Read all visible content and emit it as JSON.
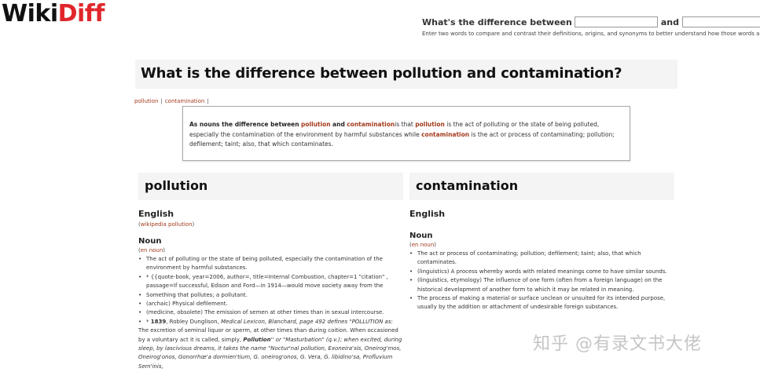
{
  "logo": {
    "wiki": "Wiki",
    "diff": "Diff"
  },
  "compare": {
    "label": "What's the difference between",
    "and_label": "and",
    "input1_value": "",
    "input2_value": "",
    "button_label": "?",
    "help_text": "Enter two words to compare and contrast their definitions, origins, and synonyms to better understand how those words are related."
  },
  "title": "What is the difference between pollution and contamination?",
  "crumbs": {
    "item1": "pollution",
    "sep": "|",
    "item2": "contamination"
  },
  "summary": {
    "lead": "As nouns the difference between",
    "word1": "pollution",
    "and": "and",
    "word2": "contamination",
    "is_that": "is that",
    "word1b": "pollution",
    "def1": "is the act of polluting or the state of being polluted, especially the contamination of the environment by harmful substances while",
    "word2b": "contamination",
    "def2": "is the act or process of contaminating; pollution; defilement; taint; also, that which contaminates."
  },
  "left": {
    "heading": "pollution",
    "language": "English",
    "source_prefix": "(",
    "source_link": "wikipedia pollution",
    "source_suffix": ")",
    "pos": "Noun",
    "pos_source": "en noun",
    "defs": [
      "The act of polluting or the state of being polluted, especially the contamination of the environment by harmful substances.",
      "* {{quote-book, year=2006, author=, title=Internal Combustion, chapter=1 \"citation\" , passage=If successful, Edison and Ford—in 1914—would move society away from the",
      "Something that pollutes; a pollutant.",
      "(archaic) Physical defilement.",
      "(medicine, obsolete) The emission of semen at other times than in sexual intercourse."
    ],
    "quote_prefix": "* ",
    "quote_year": "1839",
    "quote_author": ", Robley Dunglison,",
    "quote_title": "Medical Lexicon",
    "quote_rest": ", Blanchard, page 492 defines \"POLLUTION as:",
    "quote_body": "The excretion of seminal liquor or sperm, at other times than during coition. When occasioned by a voluntary act it is called, simply,",
    "quote_bold": "Pollution",
    "quote_body2": "'' or \"Masturbation\" (q.v.); when excited, during sleep, by lascivious dreams, it takes the name \"Noctur'nal pollution, Exoneira'sis, Oneirog'mos, Oneirog'onos, Gonorrhœ'a dormien'tium, G. oneirog'onos, G. Vera, G. libidino'sa, Profluvium Sem'inis,"
  },
  "right": {
    "heading": "contamination",
    "language": "English",
    "pos": "Noun",
    "pos_source": "en noun",
    "defs": [
      "The act or process of contaminating; pollution; defilement; taint; also, that which contaminates.",
      "(linguistics) A process whereby words with related meanings come to have similar sounds.",
      "(linguistics, etymology) The influence of one form (often from a foreign language) on the historical development of another form to which it may be related in meaning.",
      "The process of making a material or surface unclean or unsuited for its intended purpose, usually by the addition or attachment of undesirable foreign substances."
    ]
  },
  "watermark": "知乎 @有录文书大佬",
  "colors": {
    "link": "#a33a1c",
    "logo_diff": "#e0262b",
    "panel_bg": "#f4f4f4"
  }
}
